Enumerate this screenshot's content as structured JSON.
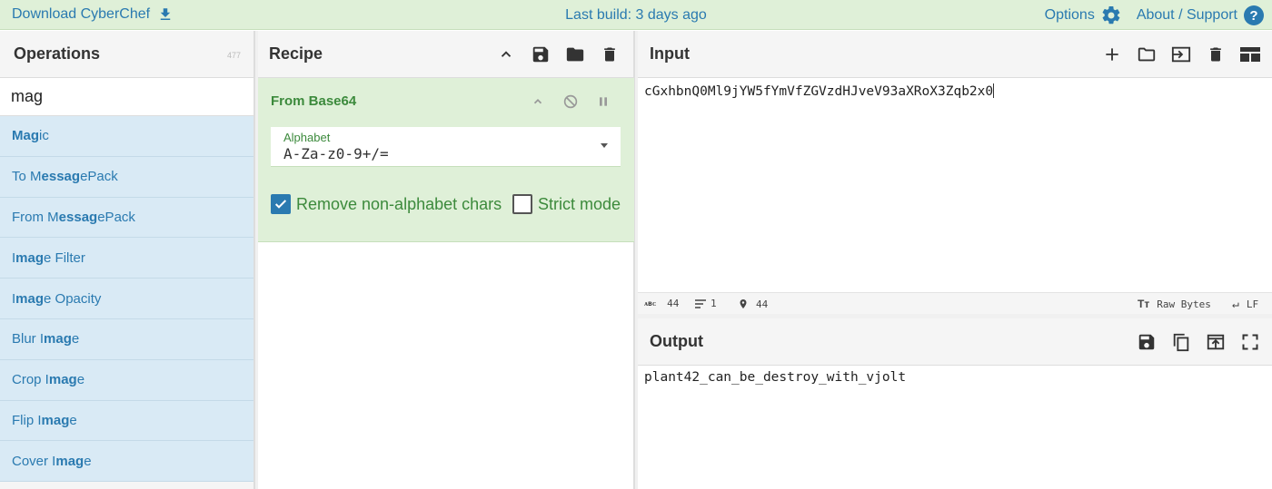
{
  "banner": {
    "download_label": "Download CyberChef",
    "last_build": "Last build: 3 days ago",
    "options_label": "Options",
    "about_label": "About / Support"
  },
  "operations": {
    "title": "Operations",
    "count": "477",
    "search_value": "mag",
    "items": [
      {
        "pre": "",
        "match": "Mag",
        "post": "ic"
      },
      {
        "pre": "To M",
        "match": "essag",
        "post": "ePack"
      },
      {
        "pre": "From M",
        "match": "essag",
        "post": "ePack"
      },
      {
        "pre": "I",
        "match": "mag",
        "post": "e Filter"
      },
      {
        "pre": "I",
        "match": "mag",
        "post": "e Opacity"
      },
      {
        "pre": "Blur I",
        "match": "mag",
        "post": "e"
      },
      {
        "pre": "Crop I",
        "match": "mag",
        "post": "e"
      },
      {
        "pre": "Flip I",
        "match": "mag",
        "post": "e"
      },
      {
        "pre": "Cover I",
        "match": "mag",
        "post": "e"
      }
    ]
  },
  "recipe": {
    "title": "Recipe",
    "operation": {
      "name": "From Base64",
      "alphabet_label": "Alphabet",
      "alphabet_value": "A-Za-z0-9+/=",
      "remove_nonalpha_label": "Remove non-alphabet chars",
      "remove_nonalpha_checked": true,
      "strict_label": "Strict mode",
      "strict_checked": false
    }
  },
  "input": {
    "title": "Input",
    "value": "cGxhbnQ0Ml9jYW5fYmVfZGVzdHJveV93aXRoX3Zqb2x0",
    "status": {
      "length": "44",
      "lines": "1",
      "position": "44",
      "encoding": "Raw Bytes",
      "eol": "LF"
    }
  },
  "output": {
    "title": "Output",
    "value": "plant42_can_be_destroy_with_vjolt"
  },
  "colors": {
    "banner_bg": "#dff0d8",
    "link": "#2a7ab0",
    "recipe_green": "#3c8a3c",
    "op_bg": "#d9eaf5"
  }
}
